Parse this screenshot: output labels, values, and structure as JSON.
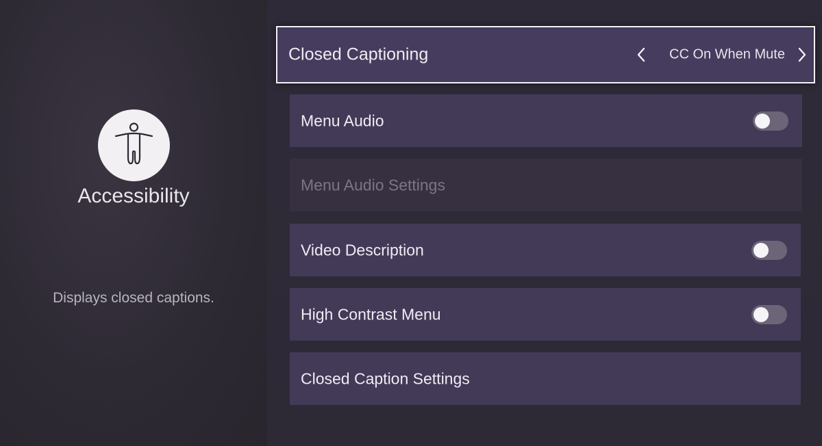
{
  "sidebar": {
    "title": "Accessibility",
    "description": "Displays closed captions.",
    "icon": "accessibility-person-icon"
  },
  "menu": {
    "items": [
      {
        "label": "Closed Captioning",
        "type": "selector",
        "value": "CC On When Mute",
        "focused": true
      },
      {
        "label": "Menu Audio",
        "type": "toggle",
        "state": "off"
      },
      {
        "label": "Menu Audio Settings",
        "type": "link",
        "disabled": true
      },
      {
        "label": "Video Description",
        "type": "toggle",
        "state": "off"
      },
      {
        "label": "High Contrast Menu",
        "type": "toggle",
        "state": "off"
      },
      {
        "label": "Closed Caption Settings",
        "type": "link"
      }
    ]
  },
  "colors": {
    "row_background": "#433a58",
    "focus_border": "#f4f2f6",
    "disabled_text": "#7c7589",
    "toggle_off": "#6c6578"
  }
}
